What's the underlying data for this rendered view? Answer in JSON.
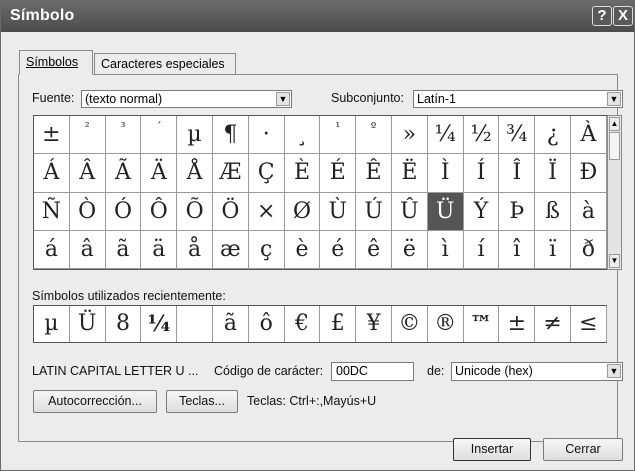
{
  "window": {
    "title": "Símbolo",
    "help_glyph": "?",
    "close_glyph": "X"
  },
  "tabs": [
    {
      "label": "Símbolos",
      "active": true
    },
    {
      "label": "Caracteres especiales",
      "active": false
    }
  ],
  "font": {
    "label": "Fuente:",
    "value": "(texto normal)"
  },
  "subset": {
    "label": "Subconjunto:",
    "value": "Latín-1"
  },
  "symbol_grid": {
    "rows": [
      [
        "±",
        "²",
        "³",
        "´",
        "µ",
        "¶",
        "·",
        "¸",
        "¹",
        "º",
        "»",
        "¼",
        "½",
        "¾",
        "¿",
        "À"
      ],
      [
        "Á",
        "Â",
        "Ã",
        "Ä",
        "Å",
        "Æ",
        "Ç",
        "È",
        "É",
        "Ê",
        "Ë",
        "Ì",
        "Í",
        "Î",
        "Ï",
        "Ð"
      ],
      [
        "Ñ",
        "Ò",
        "Ó",
        "Ô",
        "Õ",
        "Ö",
        "×",
        "Ø",
        "Ù",
        "Ú",
        "Û",
        "Ü",
        "Ý",
        "Þ",
        "ß",
        "à"
      ],
      [
        "á",
        "â",
        "ã",
        "ä",
        "å",
        "æ",
        "ç",
        "è",
        "é",
        "ê",
        "ë",
        "ì",
        "í",
        "î",
        "ï",
        "ð"
      ]
    ],
    "selected": "Ü"
  },
  "recent": {
    "label": "Símbolos utilizados recientemente:",
    "symbols": [
      "µ",
      "Ü",
      "8",
      "¼",
      "",
      "ã",
      "ô",
      "€",
      "£",
      "¥",
      "©",
      "®",
      "™",
      "±",
      "≠",
      "≤"
    ]
  },
  "char_name": "LATIN CAPITAL LETTER U ...",
  "char_code": {
    "label": "Código de carácter:",
    "value": "00DC"
  },
  "from": {
    "label": "de:",
    "value": "Unicode (hex)"
  },
  "buttons": {
    "autocorrect": "Autocorrección...",
    "shortcut_key": "Teclas...",
    "insert": "Insertar",
    "close": "Cerrar"
  },
  "shortcut_text": "Teclas: Ctrl+:,Mayús+U"
}
